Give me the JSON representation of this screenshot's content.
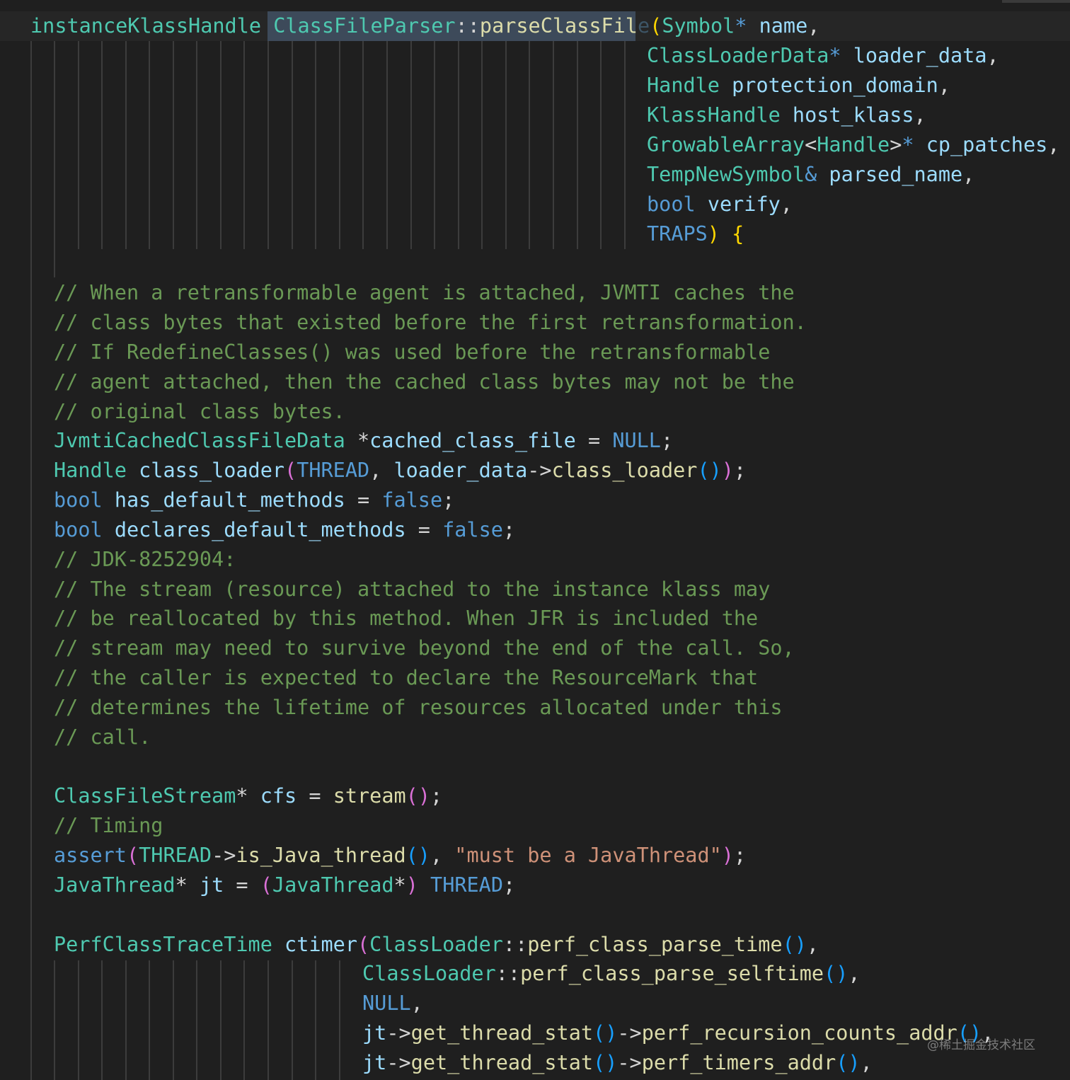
{
  "editor": {
    "language": "cpp",
    "theme_colors": {
      "background": "#1f1f1f",
      "type": "#4ec9b0",
      "keyword": "#569cd6",
      "variable": "#9cdcfe",
      "function": "#dcdcaa",
      "comment": "#6a9955",
      "string": "#ce9178",
      "bracket_level1": "#ffd700",
      "bracket_level2": "#da70d6",
      "bracket_level3": "#179fff"
    },
    "code": {
      "l1": {
        "ret_type": "instanceKlassHandle",
        "cls": "ClassFileParser",
        "sep": "::",
        "fn": "parseClassFil",
        "fn_hidden": "e",
        "open": "(",
        "p_type": "Symbol",
        "p_star": "*",
        "p_name": "name",
        "comma": ","
      },
      "l2": {
        "type": "ClassLoaderData",
        "star": "*",
        "name": "loader_data",
        "comma": ","
      },
      "l3": {
        "type": "Handle",
        "name": "protection_domain",
        "comma": ","
      },
      "l4": {
        "type": "KlassHandle",
        "name": "host_klass",
        "comma": ","
      },
      "l5": {
        "type": "GrowableArray",
        "lt": "<",
        "inner": "Handle",
        "gt": ">",
        "star": "*",
        "name": "cp_patches",
        "comma": ","
      },
      "l6": {
        "type": "TempNewSymbol",
        "amp": "&",
        "name": "parsed_name",
        "comma": ","
      },
      "l7": {
        "type": "bool",
        "name": "verify",
        "comma": ","
      },
      "l8": {
        "type": "TRAPS",
        "close": ")",
        "brace": "{"
      },
      "c1": "// When a retransformable agent is attached, JVMTI caches the",
      "c2": "// class bytes that existed before the first retransformation.",
      "c3": "// If RedefineClasses() was used before the retransformable",
      "c4": "// agent attached, then the cached class bytes may not be the",
      "c5": "// original class bytes.",
      "l14": {
        "type": "JvmtiCachedClassFileData",
        "star": " *",
        "name": "cached_class_file",
        "eq": " = ",
        "val": "NULL",
        "semi": ";"
      },
      "l15": {
        "type": "Handle",
        "name": "class_loader",
        "open": "(",
        "arg1": "THREAD",
        "comma": ", ",
        "obj": "loader_data",
        "arrow": "->",
        "fn": "class_loader",
        "call": "()",
        "close": ")",
        "semi": ";"
      },
      "l16": {
        "kw": "bool",
        "name": "has_default_methods",
        "eq": " = ",
        "val": "false",
        "semi": ";"
      },
      "l17": {
        "kw": "bool",
        "name": "declares_default_methods",
        "eq": " = ",
        "val": "false",
        "semi": ";"
      },
      "c6": "// JDK-8252904:",
      "c7": "// The stream (resource) attached to the instance klass may",
      "c8": "// be reallocated by this method. When JFR is included the",
      "c9": "// stream may need to survive beyond the end of the call. So,",
      "c10": "// the caller is expected to declare the ResourceMark that",
      "c11": "// determines the lifetime of resources allocated under this",
      "c12": "// call.",
      "l26": {
        "type": "ClassFileStream",
        "star": "*",
        "name": "cfs",
        "eq": " = ",
        "fn": "stream",
        "call": "()",
        "semi": ";"
      },
      "c13": "// Timing",
      "l28": {
        "fn": "assert",
        "open": "(",
        "arg": "THREAD",
        "arrow": "->",
        "fn2": "is_Java_thread",
        "call": "()",
        "comma": ", ",
        "str": "\"must be a JavaThread\"",
        "close": ")",
        "semi": ";"
      },
      "l29": {
        "type": "JavaThread",
        "star": "*",
        "name": "jt",
        "eq": " = ",
        "open": "(",
        "cast": "JavaThread",
        "cstar": "*",
        "close": ")",
        "val": "THREAD",
        "semi": ";"
      },
      "l31": {
        "type": "PerfClassTraceTime",
        "name": "ctimer",
        "open": "(",
        "cls": "ClassLoader",
        "sep": "::",
        "fn": "perf_class_parse_time",
        "call": "()",
        "comma": ","
      },
      "l32": {
        "cls": "ClassLoader",
        "sep": "::",
        "fn": "perf_class_parse_selftime",
        "call": "()",
        "comma": ","
      },
      "l33": {
        "val": "NULL",
        "comma": ","
      },
      "l34": {
        "obj": "jt",
        "arrow": "->",
        "fn": "get_thread_stat",
        "call": "()",
        "arrow2": "->",
        "fn2": "perf_recursion_counts_addr",
        "call2": "()",
        "comma": ","
      },
      "l35": {
        "obj": "jt",
        "arrow": "->",
        "fn": "get_thread_stat",
        "call": "()",
        "arrow2": "->",
        "fn2": "perf_timers_addr",
        "call2": "()",
        "comma": ","
      }
    }
  },
  "watermark": "@稀土掘金技术社区"
}
